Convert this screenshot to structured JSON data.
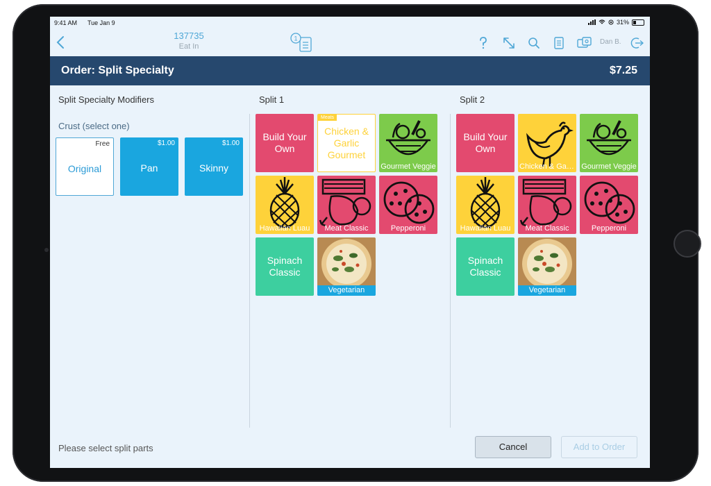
{
  "status": {
    "time": "9:41 AM",
    "date": "Tue Jan 9",
    "battery": "31%"
  },
  "nav": {
    "order_number": "137735",
    "order_type": "Eat In",
    "guest_count": "1",
    "user": "Dan B."
  },
  "header": {
    "title": "Order: Split Specialty",
    "price": "$7.25"
  },
  "modifiers": {
    "title": "Split Specialty Modifiers",
    "crust_label": "Crust (select one)",
    "options": [
      {
        "name": "Original",
        "price": "Free"
      },
      {
        "name": "Pan",
        "price": "$1.00"
      },
      {
        "name": "Skinny",
        "price": "$1.00"
      }
    ]
  },
  "split1": {
    "title": "Split 1",
    "tiles": [
      {
        "name": "Build Your Own"
      },
      {
        "name": "Chicken & Garlic Gourmet",
        "badge": "Meats"
      },
      {
        "name": "Gourmet Veggie"
      },
      {
        "name": "Hawaiian Luau"
      },
      {
        "name": "Meat Classic"
      },
      {
        "name": "Pepperoni"
      },
      {
        "name": "Spinach Classic"
      },
      {
        "name": "Vegetarian"
      }
    ]
  },
  "split2": {
    "title": "Split 2",
    "tiles": [
      {
        "name": "Build Your Own"
      },
      {
        "name": "Chicken & Garlic"
      },
      {
        "name": "Gourmet Veggie"
      },
      {
        "name": "Hawaiian Luau"
      },
      {
        "name": "Meat Classic"
      },
      {
        "name": "Pepperoni"
      },
      {
        "name": "Spinach Classic"
      },
      {
        "name": "Vegetarian"
      }
    ]
  },
  "footer": {
    "hint": "Please select split parts",
    "cancel": "Cancel",
    "add": "Add to Order"
  },
  "colors": {
    "accent": "#1aa6df",
    "header": "#26486e",
    "pink": "#e34a6f",
    "yellow": "#fed23a",
    "green": "#7dcb4b",
    "teal": "#3dcf9f"
  }
}
